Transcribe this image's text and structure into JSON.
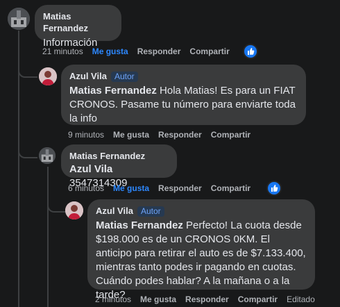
{
  "comments": [
    {
      "author": "Matias Fernandez",
      "badge": "",
      "mention": "",
      "text": "Información",
      "time": "21 minutos",
      "like": "Me gusta",
      "liked": true,
      "reply": "Responder",
      "share": "Compartir",
      "edited": ""
    },
    {
      "author": "Azul Vila",
      "badge": "Autor",
      "mention": "Matias Fernandez",
      "text": "Hola Matias! Es para un FIAT CRONOS. Pasame tu número para enviarte toda la info",
      "time": "9 minutos",
      "like": "Me gusta",
      "liked": false,
      "reply": "Responder",
      "share": "Compartir",
      "edited": ""
    },
    {
      "author": "Matias Fernandez",
      "badge": "",
      "mention": "Azul Vila",
      "text": "3547314309",
      "time": "6 minutos",
      "like": "Me gusta",
      "liked": true,
      "reply": "Responder",
      "share": "Compartir",
      "edited": ""
    },
    {
      "author": "Azul Vila",
      "badge": "Autor",
      "mention": "Matias Fernandez",
      "text": "Perfecto! La cuota desde $198.000 es de un CRONOS 0KM. El anticipo para retirar el auto es de $7.133.400, mientras tanto podes ir pagando en cuotas. Cuándo podes hablar? A la mañana o a la tarde?",
      "time": "2 minutos",
      "like": "Me gusta",
      "liked": false,
      "reply": "Responder",
      "share": "Compartir",
      "edited": "Editado"
    }
  ],
  "colors": {
    "background": "#18191a",
    "bubble": "#3a3b3c",
    "liked": "#2d88ff",
    "badge": "#6ea3f8"
  }
}
